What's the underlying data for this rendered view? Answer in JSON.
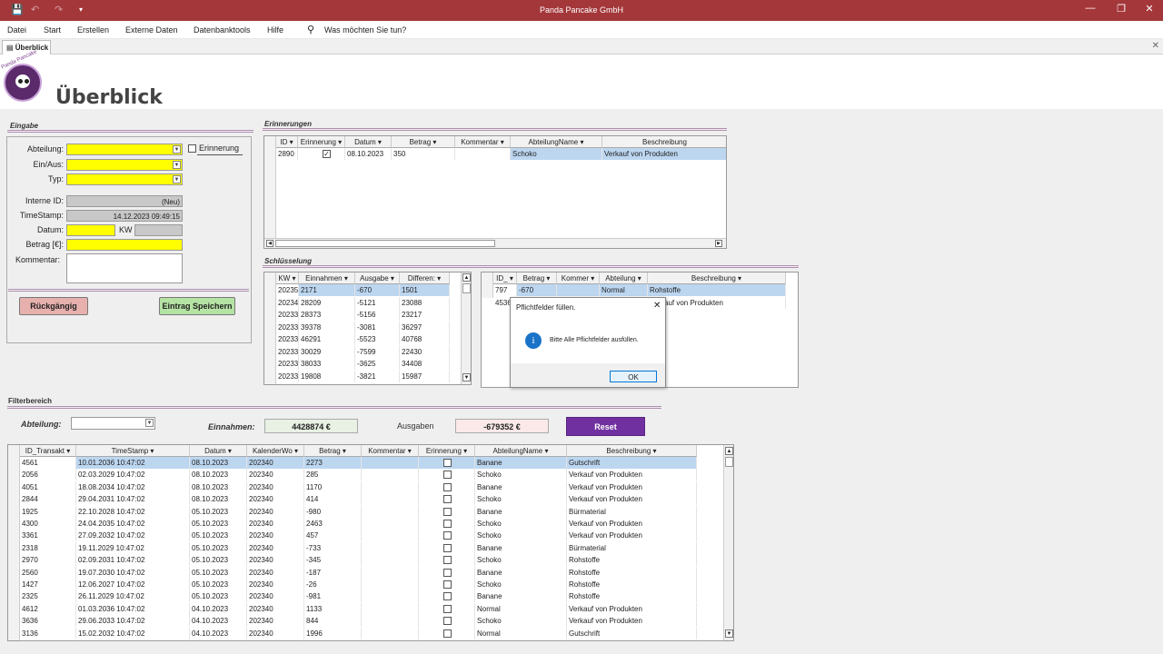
{
  "app": {
    "title": "Panda Pancake GmbH",
    "menu": [
      "Datei",
      "Start",
      "Erstellen",
      "Externe Daten",
      "Datenbanktools",
      "Hilfe"
    ],
    "search_placeholder": "Was möchten Sie tun?",
    "doc_tab": "Überblick"
  },
  "header": {
    "logo_text": "Panda Pancake",
    "title": "Überblick"
  },
  "eingabe": {
    "section": "Eingabe",
    "labels": {
      "abteilung": "Abteilung:",
      "einaus": "Ein/Aus:",
      "typ": "Typ:",
      "interne_id": "Interne ID:",
      "timestamp": "TimeStamp:",
      "datum": "Datum:",
      "kw": "KW",
      "betrag": "Betrag [€]:",
      "kommentar": "Kommentar:"
    },
    "erinnerung_label": "Erinnerung",
    "interne_id_value": "(Neu)",
    "timestamp_value": "14.12.2023 09:49:15",
    "undo_label": "Rückgängig",
    "save_label": "Eintrag Speichern"
  },
  "erinnerungen": {
    "section": "Erinnerungen",
    "columns": [
      "ID",
      "Erinnerung",
      "Datum",
      "Betrag",
      "Kommentar",
      "AbteilungName",
      "Beschreibung"
    ],
    "row": {
      "id": "2890",
      "datum": "08.10.2023",
      "betrag": "350",
      "abteilung": "Schoko",
      "beschreibung": "Verkauf von Produkten"
    }
  },
  "schluesselung": {
    "section": "Schlüsselung",
    "columns": [
      "KW",
      "Einnahmen",
      "Ausgabe",
      "Differen:"
    ],
    "rows": [
      [
        "202352",
        "2171",
        "-670",
        "1501"
      ],
      [
        "202340",
        "28209",
        "-5121",
        "23088"
      ],
      [
        "202339",
        "28373",
        "-5156",
        "23217"
      ],
      [
        "202338",
        "39378",
        "-3081",
        "36297"
      ],
      [
        "202337",
        "46291",
        "-5523",
        "40768"
      ],
      [
        "202336",
        "30029",
        "-7599",
        "22430"
      ],
      [
        "202335",
        "38033",
        "-3625",
        "34408"
      ],
      [
        "202334",
        "19808",
        "-3821",
        "15987"
      ]
    ],
    "right_columns": [
      "ID_",
      "Betrag",
      "Kommer",
      "Abteilung",
      "Beschreibung"
    ],
    "right_rows": [
      [
        "797",
        "-670",
        "",
        "Normal",
        "Rohstoffe"
      ],
      [
        "4536",
        "",
        "",
        "",
        "Verkauf von Produkten"
      ]
    ]
  },
  "dialog": {
    "title": "Pflichtfelder füllen.",
    "message": "Bitte Alle Pflichtfelder ausfüllen.",
    "ok": "OK"
  },
  "filter": {
    "section": "Filterbereich",
    "abteilung_label": "Abteilung:",
    "einnahmen_label": "Einnahmen:",
    "einnahmen_value": "4428874 €",
    "ausgaben_label": "Ausgaben",
    "ausgaben_value": "-679352 €",
    "reset_label": "Reset",
    "columns": [
      "ID_Transakt",
      "TimeStamp",
      "Datum",
      "KalenderWo",
      "Betrag",
      "Kommentar",
      "Erinnerung",
      "AbteilungName",
      "Beschreibung"
    ],
    "rows": [
      [
        "4561",
        "10.01.2036 10:47:02",
        "08.10.2023",
        "202340",
        "2273",
        "",
        "Banane",
        "Gutschrift"
      ],
      [
        "2056",
        "02.03.2029 10:47:02",
        "08.10.2023",
        "202340",
        "285",
        "",
        "Schoko",
        "Verkauf von Produkten"
      ],
      [
        "4051",
        "18.08.2034 10:47:02",
        "08.10.2023",
        "202340",
        "1170",
        "",
        "Banane",
        "Verkauf von Produkten"
      ],
      [
        "2844",
        "29.04.2031 10:47:02",
        "08.10.2023",
        "202340",
        "414",
        "",
        "Schoko",
        "Verkauf von Produkten"
      ],
      [
        "1925",
        "22.10.2028 10:47:02",
        "05.10.2023",
        "202340",
        "-980",
        "",
        "Banane",
        "Bürmaterial"
      ],
      [
        "4300",
        "24.04.2035 10:47:02",
        "05.10.2023",
        "202340",
        "2463",
        "",
        "Schoko",
        "Verkauf von Produkten"
      ],
      [
        "3361",
        "27.09.2032 10:47:02",
        "05.10.2023",
        "202340",
        "457",
        "",
        "Schoko",
        "Verkauf von Produkten"
      ],
      [
        "2318",
        "19.11.2029 10:47:02",
        "05.10.2023",
        "202340",
        "-733",
        "",
        "Banane",
        "Bürmaterial"
      ],
      [
        "2970",
        "02.09.2031 10:47:02",
        "05.10.2023",
        "202340",
        "-345",
        "",
        "Schoko",
        "Rohstoffe"
      ],
      [
        "2560",
        "19.07.2030 10:47:02",
        "05.10.2023",
        "202340",
        "-187",
        "",
        "Banane",
        "Rohstoffe"
      ],
      [
        "1427",
        "12.06.2027 10:47:02",
        "05.10.2023",
        "202340",
        "-26",
        "",
        "Schoko",
        "Rohstoffe"
      ],
      [
        "2325",
        "26.11.2029 10:47:02",
        "05.10.2023",
        "202340",
        "-981",
        "",
        "Banane",
        "Rohstoffe"
      ],
      [
        "4612",
        "01.03.2036 10:47:02",
        "04.10.2023",
        "202340",
        "1133",
        "",
        "Normal",
        "Verkauf von Produkten"
      ],
      [
        "3636",
        "29.06.2033 10:47:02",
        "04.10.2023",
        "202340",
        "844",
        "",
        "Schoko",
        "Verkauf von Produkten"
      ],
      [
        "3136",
        "15.02.2032 10:47:02",
        "04.10.2023",
        "202340",
        "1996",
        "",
        "Normal",
        "Gutschrift"
      ]
    ]
  },
  "colors": {
    "titlebar": "#a4373a",
    "required": "#ffff00",
    "selection": "#bcd6f0",
    "reset": "#7030a0"
  }
}
